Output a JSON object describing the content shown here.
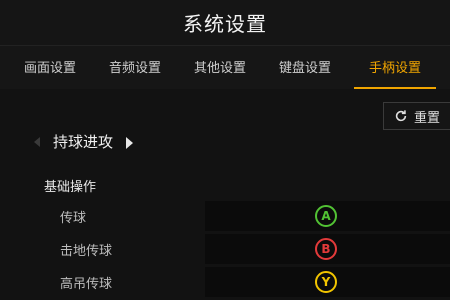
{
  "window": {
    "title": "系统设置"
  },
  "tabs": [
    {
      "label": "画面设置",
      "active": false
    },
    {
      "label": "音频设置",
      "active": false
    },
    {
      "label": "其他设置",
      "active": false
    },
    {
      "label": "键盘设置",
      "active": false
    },
    {
      "label": "手柄设置",
      "active": true
    }
  ],
  "toolbar": {
    "reset_label": "重置",
    "reset_icon": "refresh-icon"
  },
  "preset": {
    "label": "持球进攻"
  },
  "section": {
    "title": "基础操作"
  },
  "bindings": [
    {
      "action": "传球",
      "button": "A",
      "color": "#52c234"
    },
    {
      "action": "击地传球",
      "button": "B",
      "color": "#e23a3a"
    },
    {
      "action": "高吊传球",
      "button": "Y",
      "color": "#f2c500"
    }
  ],
  "colors": {
    "accent": "#f0a500",
    "background": "#101010"
  }
}
